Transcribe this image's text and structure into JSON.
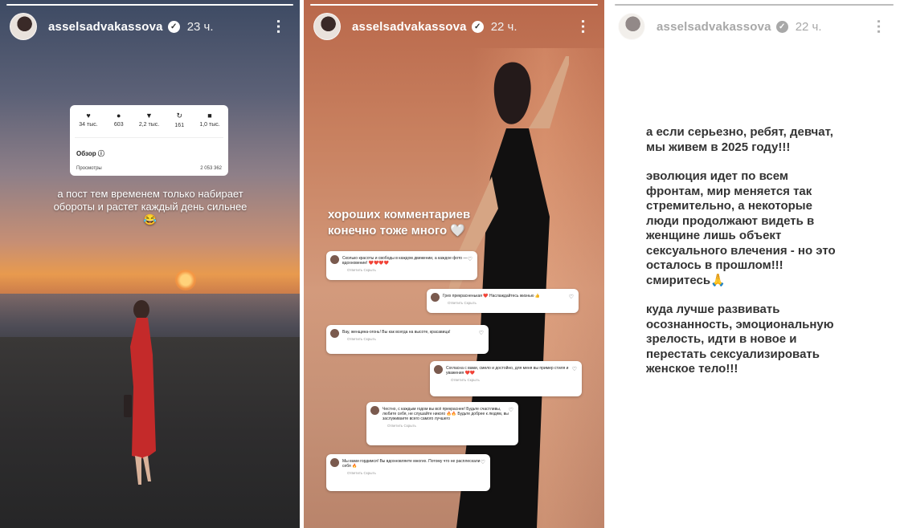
{
  "stories": [
    {
      "username": "asselsadvakassova",
      "time": "23 ч.",
      "insights": {
        "stats": [
          {
            "icon": "heart-icon",
            "value": "34 тыс."
          },
          {
            "icon": "comment-icon",
            "value": "603"
          },
          {
            "icon": "send-icon",
            "value": "2,2 тыс."
          },
          {
            "icon": "repost-icon",
            "value": "161"
          },
          {
            "icon": "bookmark-icon",
            "value": "1,0 тыс."
          }
        ],
        "overview_label": "Обзор",
        "views_label": "Просмотры",
        "views_value": "2 053 362"
      },
      "caption": "а пост тем временем только набирает обороты и растет каждый день сильнее😂"
    },
    {
      "username": "asselsadvakassova",
      "time": "22 ч.",
      "caption_line1": "хороших комментариев",
      "caption_line2": "конечно тоже много 🤍",
      "comments": [
        {
          "text": "Сколько красоты и свободы в каждом движении, а каждое фото — вдохновение! ❤️❤️❤️❤️",
          "actions": "Ответить   Скрыть"
        },
        {
          "text": "Грех прекрасненькая ❤️ Наслаждайтесь жизнью 👍",
          "actions": "Ответить   Скрыть"
        },
        {
          "text": "Вау, женщина-огонь! Вы как всегда на высоте, красавица!",
          "actions": "Ответить   Скрыть"
        },
        {
          "text": "Согласна с вами, смело и достойно, для меня вы пример стиля и уважения ❤️❤️",
          "actions": "Ответить   Скрыть"
        },
        {
          "text": "Честно, с каждым годом вы всё прекраснее! Будьте счастливы, любите себя, не слушайте никого 🔥🔥 Будьте добрее к людям, вы заслуживаете всего самого лучшего",
          "actions": "Ответить   Скрыть"
        },
        {
          "text": "Мы вами гордимся! Вы вдохновляете многих. Потому что не расплескали себя 🔥",
          "actions": "Ответить   Скрыть"
        }
      ]
    },
    {
      "username": "asselsadvakassova",
      "time": "22 ч.",
      "paragraphs": [
        "а если серьезно, ребят, девчат, мы живем в 2025 году!!!",
        "эволюция идет по всем фронтам, мир меняется так стремительно, а некоторые люди продолжают видеть в женщине лишь объект сексуального влечения - но это осталось в прошлом!!! смиритесь🙏",
        "куда лучше развивать осознанность, эмоциональную зрелость, идти в новое и перестать сексуализировать женское тело!!!"
      ]
    }
  ],
  "colors": {
    "story_white_bg": "#ffffff",
    "essay_text": "#333333"
  }
}
